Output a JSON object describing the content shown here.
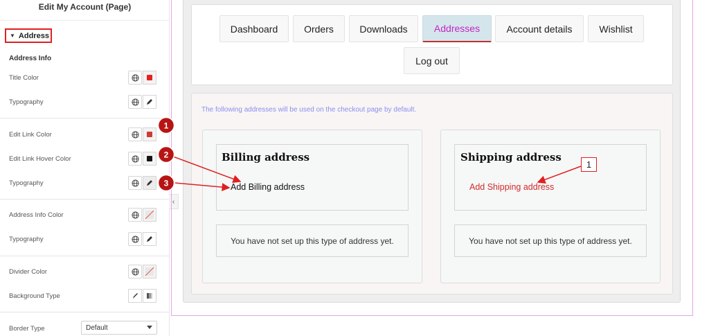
{
  "panel": {
    "title": "Edit My Account (Page)",
    "section_label": "Address",
    "subheading": "Address Info",
    "controls": {
      "title_color": "Title Color",
      "typography_1": "Typography",
      "edit_link_color": "Edit Link Color",
      "edit_link_hover_color": "Edit Link Hover Color",
      "typography_2": "Typography",
      "address_info_color": "Address Info Color",
      "typography_3": "Typography",
      "divider_color": "Divider Color",
      "background_type": "Background Type",
      "border_type": "Border Type"
    },
    "border_type_value": "Default",
    "swatches": {
      "title_color": "#e8201e",
      "edit_link_color": "#cf3a35",
      "edit_link_hover_color": "#141414"
    }
  },
  "nav": {
    "tabs": [
      "Dashboard",
      "Orders",
      "Downloads",
      "Addresses",
      "Account details",
      "Wishlist"
    ],
    "logout": "Log out",
    "active_tab": "Addresses"
  },
  "addresses": {
    "notice": "The following addresses will be used on the checkout page by default.",
    "billing": {
      "title": "Billing address",
      "link": "Add Billing address",
      "message": "You have not set up this type of address yet."
    },
    "shipping": {
      "title": "Shipping address",
      "link": "Add Shipping address",
      "message": "You have not set up this type of address yet."
    }
  },
  "annotations": {
    "badge_1": "1",
    "badge_2": "2",
    "badge_3": "3",
    "box_1": "1"
  },
  "colors": {
    "accent_red": "#e02020",
    "active_tab_text": "#c326c3",
    "active_tab_bg": "#d4e6ec",
    "billing_link": "#111111",
    "shipping_link": "#d12b2b",
    "notice_text": "#8d8df0"
  }
}
